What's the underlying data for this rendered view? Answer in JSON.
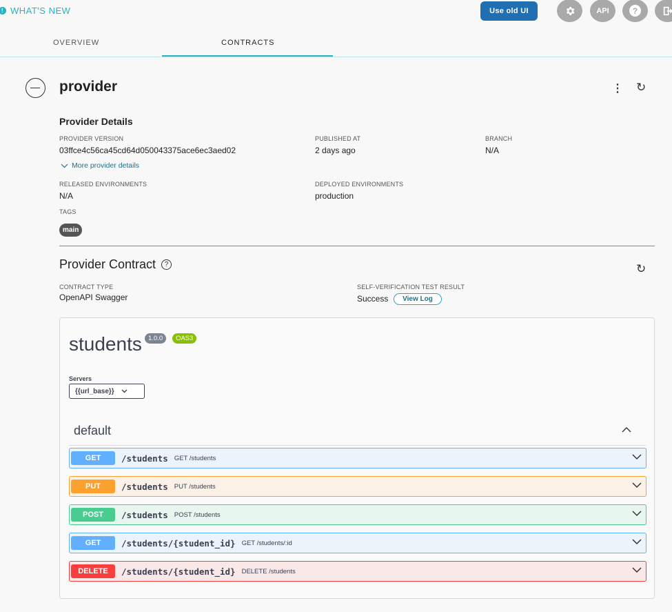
{
  "header": {
    "whats_new": "WHAT'S NEW",
    "whats_new_icon": "!",
    "use_old_ui": "Use old UI",
    "api_label": "API",
    "help_label": "?"
  },
  "tabs": [
    {
      "label": "OVERVIEW"
    },
    {
      "label": "CONTRACTS"
    }
  ],
  "provider": {
    "name": "provider",
    "details_heading": "Provider Details",
    "version_label": "PROVIDER VERSION",
    "version_value": "03ffce4c56ca45cd64d050043375ace6ec3aed02",
    "published_label": "PUBLISHED AT",
    "published_value": "2 days ago",
    "branch_label": "BRANCH",
    "branch_value": "N/A",
    "more_details": "More provider details",
    "released_label": "RELEASED ENVIRONMENTS",
    "released_value": "N/A",
    "deployed_label": "DEPLOYED ENVIRONMENTS",
    "deployed_value": "production",
    "tags_label": "TAGS",
    "tag": "main"
  },
  "contract": {
    "title": "Provider Contract",
    "type_label": "CONTRACT TYPE",
    "type_value": "OpenAPI Swagger",
    "result_label": "SELF-VERIFICATION TEST RESULT",
    "result_value": "Success",
    "view_log": "View Log"
  },
  "swagger": {
    "title": "students",
    "version_badge": "1.0.0",
    "oas_badge": "OAS3",
    "servers_label": "Servers",
    "server_selected": "{{url_base}}",
    "section": "default",
    "operations": [
      {
        "method": "GET",
        "path": "/students",
        "desc": "GET /students"
      },
      {
        "method": "PUT",
        "path": "/students",
        "desc": "PUT /students"
      },
      {
        "method": "POST",
        "path": "/students",
        "desc": "POST /students"
      },
      {
        "method": "GET",
        "path": "/students/{student_id}",
        "desc": "GET /students/:id"
      },
      {
        "method": "DELETE",
        "path": "/students/{student_id}",
        "desc": "DELETE /students"
      }
    ]
  },
  "colors": {
    "accent": "#2db0c0",
    "primary_button": "#1f6fb2",
    "get": "#61affe",
    "put": "#fca130",
    "post": "#49cc90",
    "delete": "#f93e3e"
  },
  "icons": {
    "settings": "gear-icon",
    "help": "help-icon",
    "logout": "logout-icon",
    "collapse": "minus-circle-icon",
    "more": "kebab-menu-icon",
    "refresh": "refresh-icon",
    "info": "question-circle-icon"
  }
}
